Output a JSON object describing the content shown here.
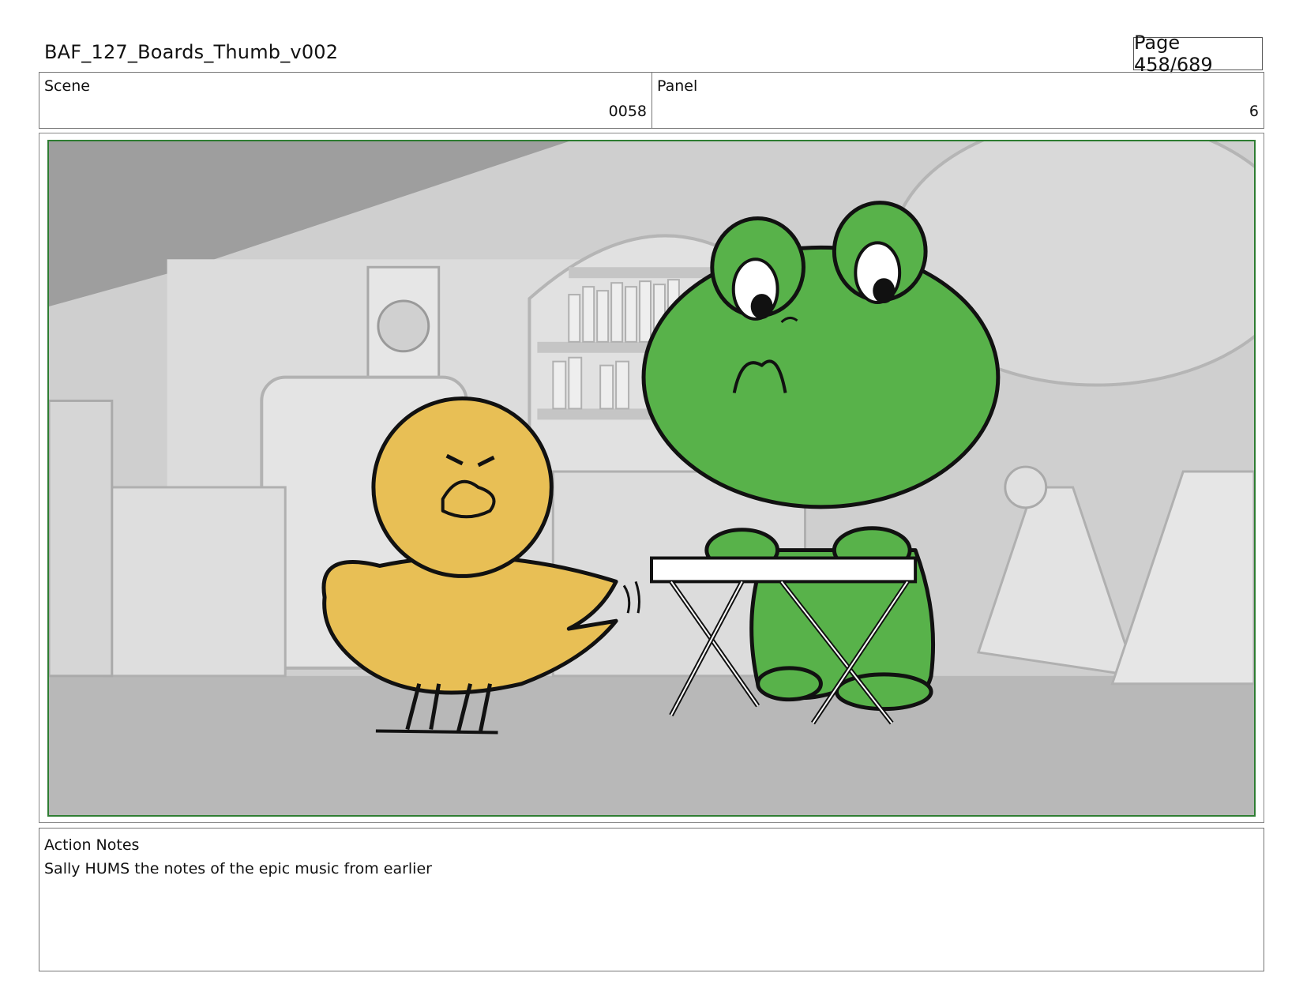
{
  "document": {
    "title": "BAF_127_Boards_Thumb_v002",
    "page_label": "Page 458/689"
  },
  "info": {
    "scene_label": "Scene",
    "scene_value": "0058",
    "panel_label": "Panel",
    "panel_value": "6"
  },
  "notes": {
    "label": "Action Notes",
    "text": "Sally HUMS the notes of the epic music from earlier"
  },
  "colors": {
    "frame_border": "#2e7d32",
    "chick_fill": "#e8bf55",
    "frog_fill": "#58b24a",
    "background_gray": "#c9c9c9"
  }
}
